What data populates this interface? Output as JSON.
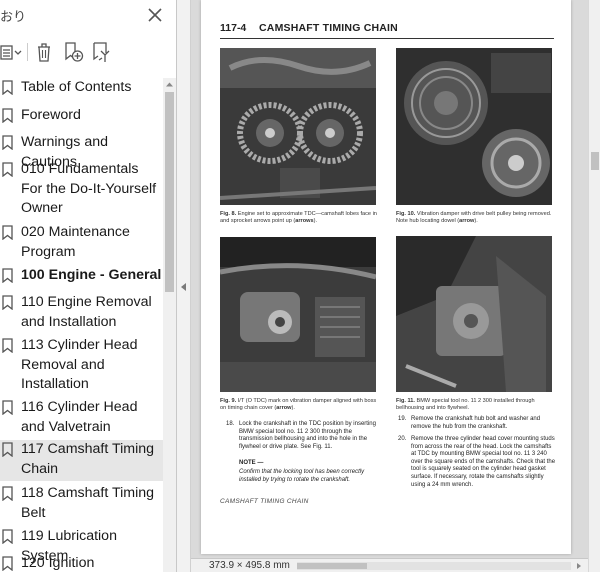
{
  "panel": {
    "title": "おり",
    "bookmarks": [
      {
        "label": "Table of Contents",
        "bold": false
      },
      {
        "label": "Foreword",
        "bold": false
      },
      {
        "label": "Warnings and Cautions",
        "bold": false
      },
      {
        "label": "010 Fundamentals For the Do-It-Yourself Owner",
        "bold": false
      },
      {
        "label": "020 Maintenance Program",
        "bold": false
      },
      {
        "label": "100 Engine - General",
        "bold": true
      },
      {
        "label": "110 Engine Removal and Installation",
        "bold": false
      },
      {
        "label": "113 Cylinder Head Removal and Installation",
        "bold": false
      },
      {
        "label": "116 Cylinder Head and Valvetrain",
        "bold": false
      },
      {
        "label": "117 Camshaft Timing Chain",
        "bold": false,
        "selected": true
      },
      {
        "label": "118 Camshaft Timing Belt",
        "bold": false
      },
      {
        "label": "119 Lubrication System",
        "bold": false
      },
      {
        "label": "120 Ignition",
        "bold": false
      }
    ]
  },
  "page": {
    "number": "117-4",
    "title": "CAMSHAFT TIMING CHAIN",
    "captions": {
      "fig8": {
        "num": "Fig. 8.",
        "text": "Engine set to approximate TDC—camshaft lobes face in and sprocket arrows point up (",
        "em": "arrows",
        "tail": ")."
      },
      "fig9": {
        "num": "Fig. 9.",
        "text": "I/T (O TDC) mark on vibration damper aligned with boss on timing chain cover (",
        "em": "arrow",
        "tail": ")."
      },
      "fig10": {
        "num": "Fig. 10.",
        "text": "Vibration damper with drive belt pulley being removed. Note hub locating dowel (",
        "em": "arrow",
        "tail": ")."
      },
      "fig11": {
        "num": "Fig. 11.",
        "text": "BMW special tool no. 11 2 300 installed through bellhousing and into flywheel.",
        "em": "",
        "tail": ""
      }
    },
    "steps": {
      "s18_num": "18.",
      "s18_text": "Lock the crankshaft in the TDC position by inserting BMW special tool no. 11 2 300 through the transmission bellhousing and into the hole in the flywheel or drive plate. See Fig. 11.",
      "note_head": "NOTE —",
      "note_text": "Confirm that the locking tool has been correctly installed by trying to rotate the crankshaft.",
      "s19_num": "19.",
      "s19_text": "Remove the crankshaft hub bolt and washer and remove the hub from the crankshaft.",
      "s20_num": "20.",
      "s20_text": "Remove the three cylinder head cover mounting studs from across the rear of the head. Lock the camshafts at TDC by mounting BMW special tool no. 11 3 240 over the square ends of the camshafts. Check that the tool is squarely seated on the cylinder head gasket surface. If necessary, rotate the camshafts slightly using a 24 mm wrench."
    },
    "footer": "CAMSHAFT TIMING CHAIN"
  },
  "status": {
    "page_size": "373.9 × 495.8 mm"
  },
  "colors": {
    "panel_bg": "#ffffff",
    "selected_bg": "#e6e6e6",
    "viewer_bg": "#dadada"
  }
}
